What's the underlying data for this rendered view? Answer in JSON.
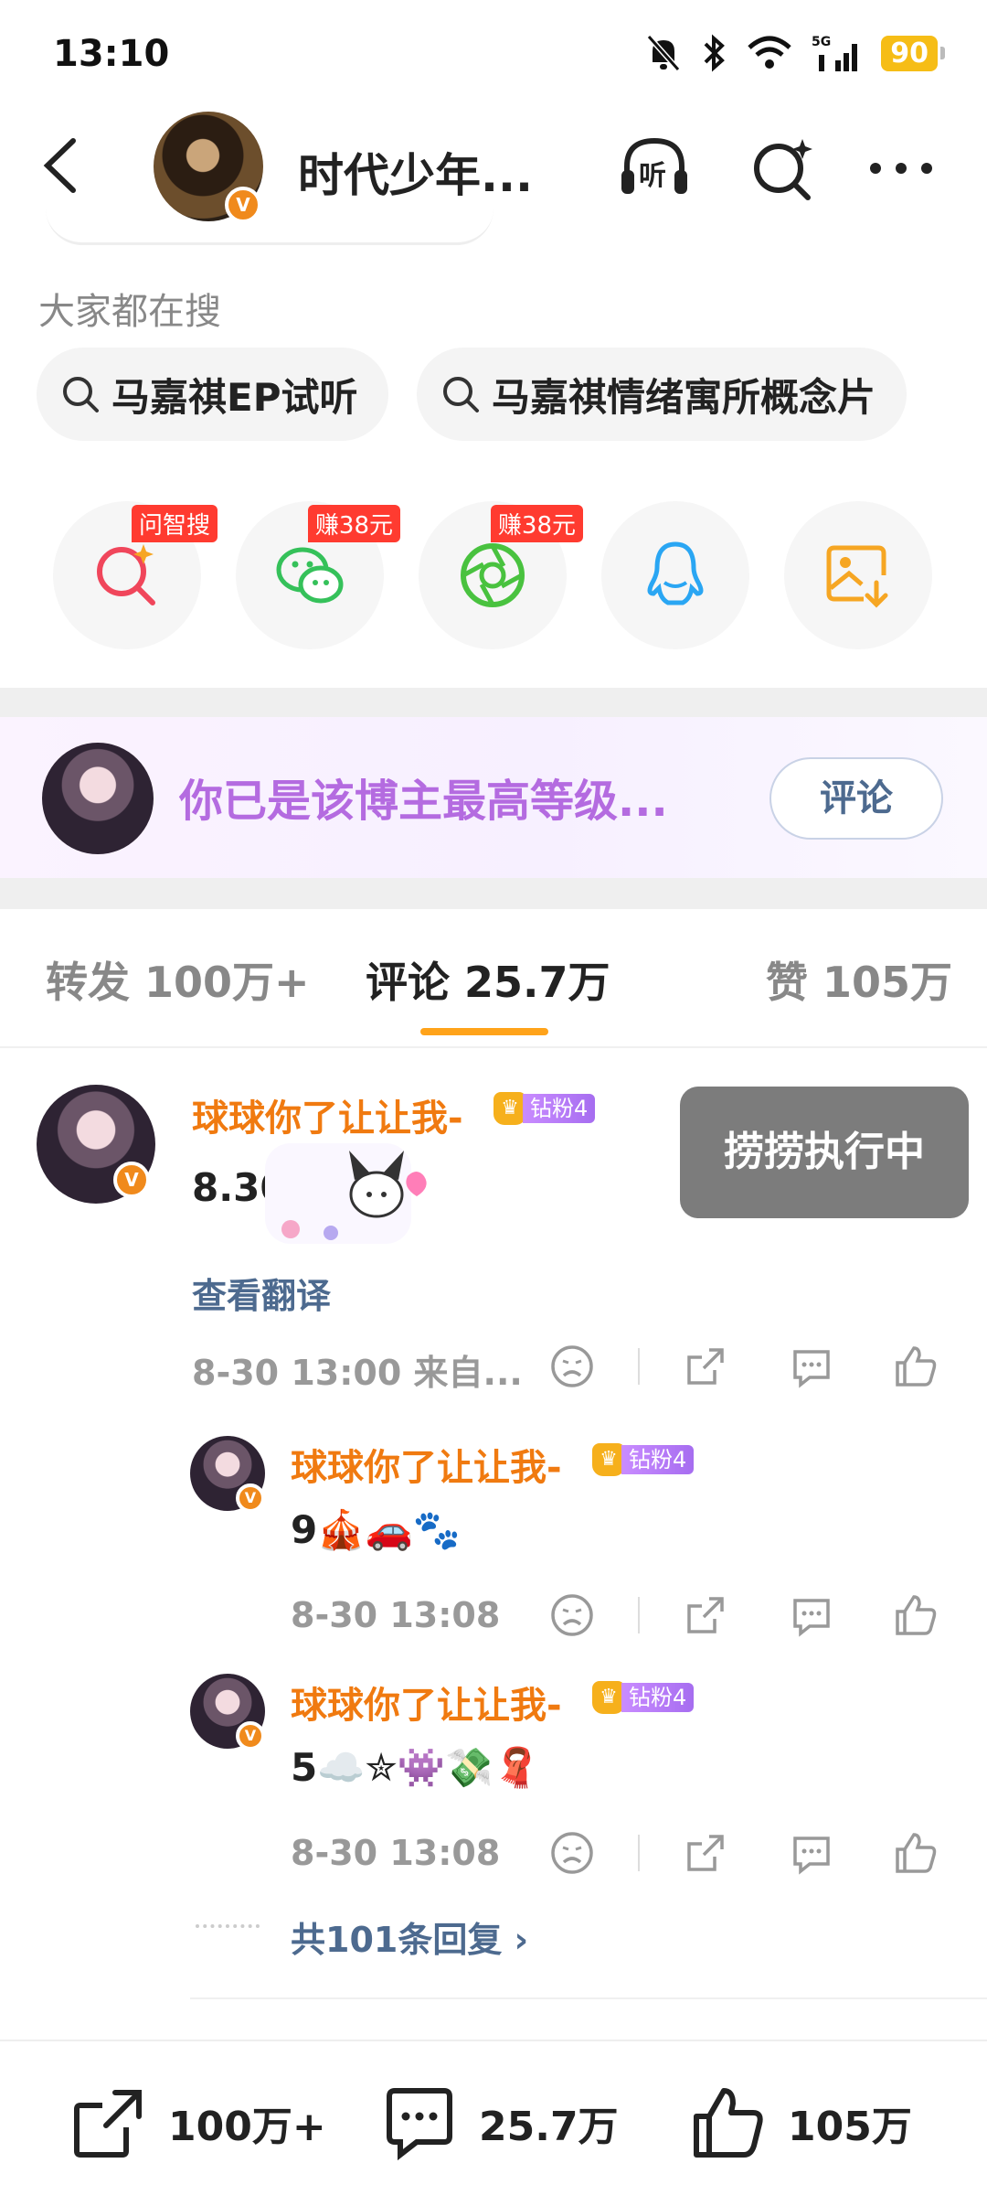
{
  "status_bar": {
    "time": "13:10",
    "network": "5G",
    "battery": "90",
    "icons": [
      "mute-bell-icon",
      "bluetooth-icon",
      "wifi-icon",
      "cell-signal-icon"
    ]
  },
  "nav": {
    "title": "时代少年...",
    "listen_label": "听",
    "icons": [
      "back-icon",
      "listen-icon",
      "ai-search-icon",
      "more-icon"
    ]
  },
  "search": {
    "section_title": "大家都在搜",
    "chips": [
      "马嘉祺EP试听",
      "马嘉祺情绪寓所概念片"
    ]
  },
  "share": {
    "items": [
      {
        "icon": "ai-search-icon",
        "tag": "问智搜",
        "color": "#f0465b"
      },
      {
        "icon": "wechat-icon",
        "tag": "赚38元",
        "color": "#35c15a"
      },
      {
        "icon": "moments-icon",
        "tag": "赚38元",
        "color": "#49c23f"
      },
      {
        "icon": "qq-icon",
        "tag": "",
        "color": "#2aa6f3"
      },
      {
        "icon": "save-image-icon",
        "tag": "",
        "color": "#f6a623"
      }
    ]
  },
  "banner": {
    "text": "你已是该博主最高等级...",
    "button": "评论"
  },
  "tabs": [
    {
      "label": "转发 100万+",
      "active": false
    },
    {
      "label": "评论 25.7万",
      "active": true
    },
    {
      "label": "赞 105万",
      "active": false
    }
  ],
  "comments": {
    "main": {
      "user": "球球你了让让我-",
      "level": "钻粉4",
      "text": "8.30zp",
      "translate": "查看翻译",
      "meta": "8-30 13:00  来自..."
    },
    "replies": [
      {
        "user": "球球你了让让我-",
        "level": "钻粉4",
        "text": "9🎪🚗🐾",
        "meta": "8-30 13:08"
      },
      {
        "user": "球球你了让让我-",
        "level": "钻粉4",
        "text": "5☁️✮👾💸🧣",
        "meta": "8-30 13:08"
      }
    ],
    "more_replies": "共101条回复 ›"
  },
  "toast": "捞捞执行中",
  "bottom_bar": {
    "repost": "100万+",
    "comment": "25.7万",
    "like": "105万"
  },
  "colors": {
    "accent": "#ffa31a",
    "username": "#f07a10",
    "link": "#4d6a8f",
    "fan_text": "#b46be0"
  }
}
